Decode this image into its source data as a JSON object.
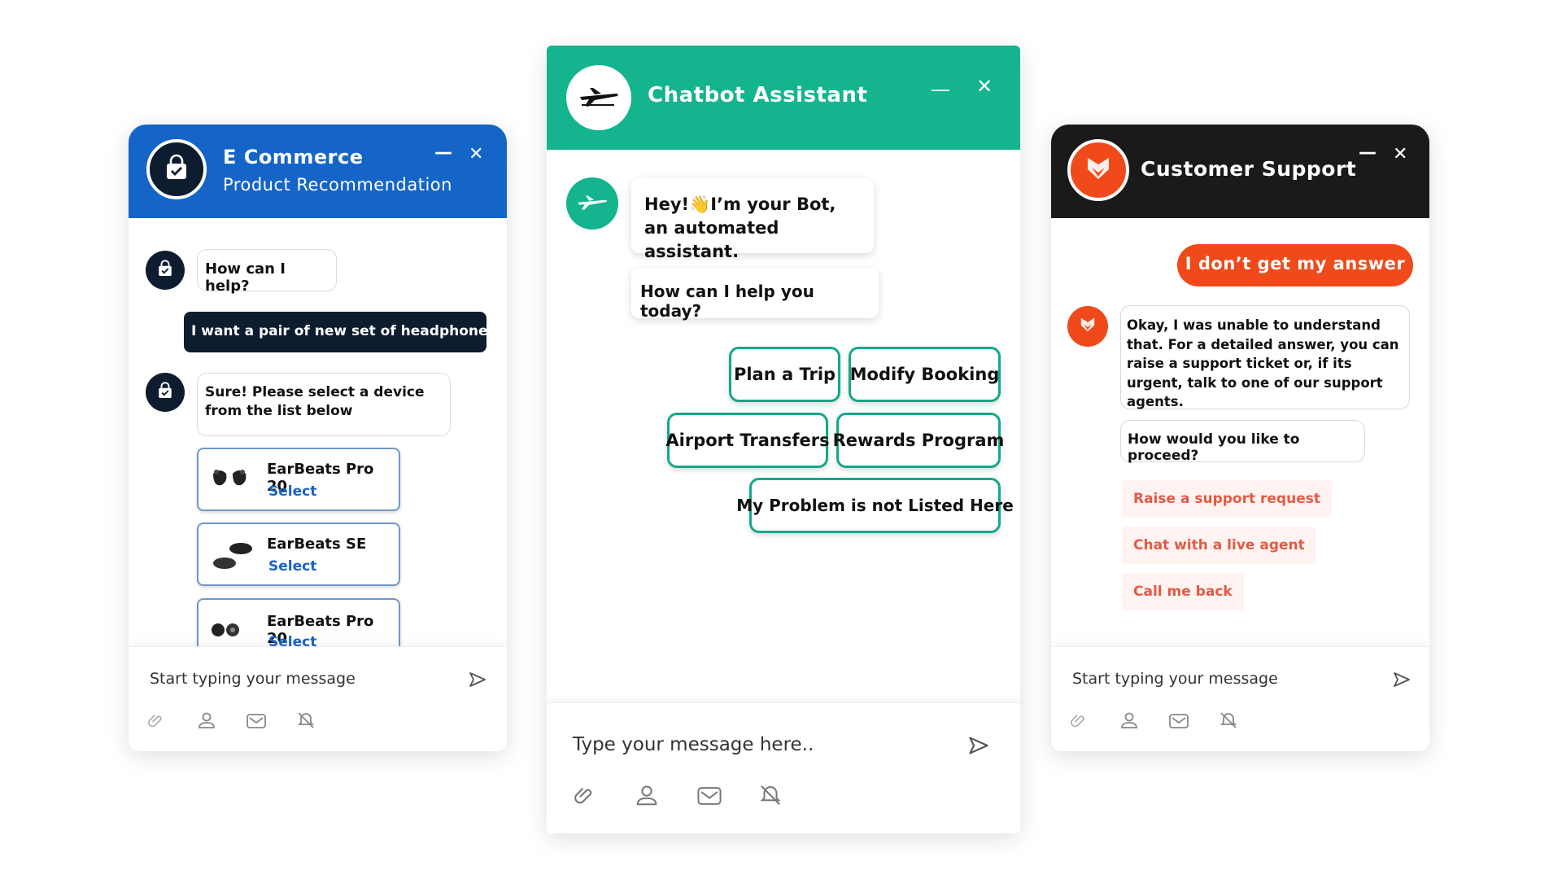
{
  "ecommerce": {
    "title": "E Commerce",
    "subtitle": "Product Recommendation",
    "header_color": "#1565c8",
    "icon": "shopping-bag-icon",
    "minimize": "—",
    "close": "✕",
    "messages": {
      "bot_greeting": "How can I help?",
      "user_request": "I want a pair of new set of headphones",
      "bot_reply": "Sure! Please select a device from the list below"
    },
    "products": [
      {
        "name": "EarBeats Pro 20",
        "select": "Select"
      },
      {
        "name": "EarBeats SE",
        "select": "Select"
      },
      {
        "name": "EarBeats Pro 20",
        "select": "Select"
      }
    ],
    "input_placeholder": "Start typing your message"
  },
  "chatbot": {
    "title": "Chatbot Assistant",
    "header_color": "#13b48e",
    "icon": "airplane-icon",
    "minimize": "—",
    "close": "✕",
    "messages": {
      "intro_line1": "Hey!👋I’m your Bot,",
      "intro_line2": "an automated assistant.",
      "question": "How can I help you today?"
    },
    "options": [
      "Plan a Trip",
      "Modify Booking",
      "Airport Transfers",
      "Rewards Program",
      "My Problem is not Listed Here"
    ],
    "input_placeholder": "Type your message here.."
  },
  "support": {
    "title": "Customer Support",
    "header_color": "#1a1a1a",
    "accent_color": "#f04a1a",
    "icon": "fox-logo-icon",
    "minimize": "—",
    "close": "✕",
    "messages": {
      "user_message": "I don’t get my answer",
      "bot_reply": "Okay, I was unable to understand that. For a detailed answer, you can raise a support  ticket or, if its urgent, talk to one of our support agents.",
      "question": "How would you like to proceed?"
    },
    "options": [
      "Raise a support request",
      "Chat with a live agent",
      "Call me back"
    ],
    "input_placeholder": "Start typing your message"
  }
}
